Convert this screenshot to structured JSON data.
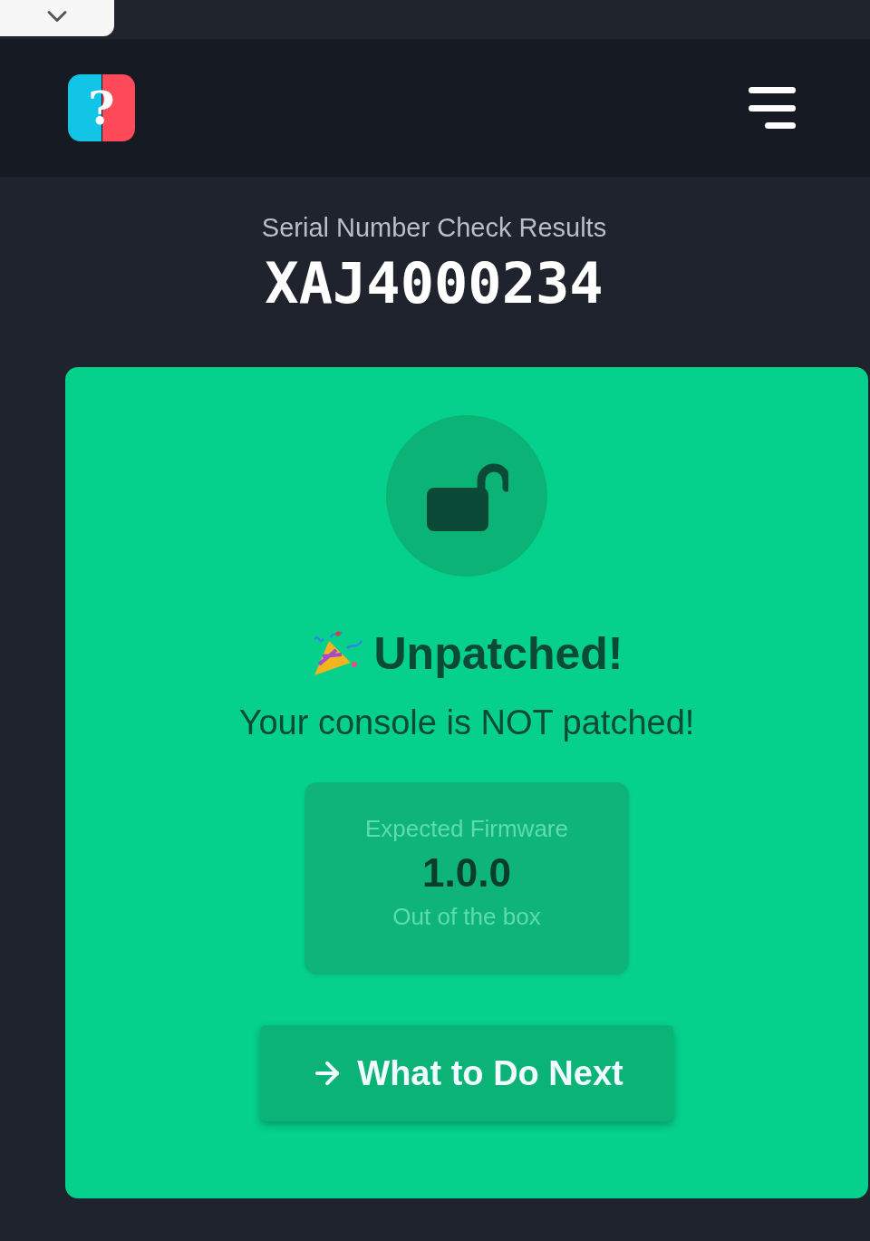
{
  "browser_tab": {
    "expanded": false
  },
  "header": {
    "logo": "?"
  },
  "heading": {
    "label": "Serial Number Check Results",
    "serial": "XAJ4000234"
  },
  "result": {
    "patched": false,
    "title": "Unpatched!",
    "message": "Your console is NOT patched!",
    "firmware": {
      "label": "Expected Firmware",
      "version": "1.0.0",
      "note": "Out of the box"
    },
    "button": "What to Do Next"
  }
}
